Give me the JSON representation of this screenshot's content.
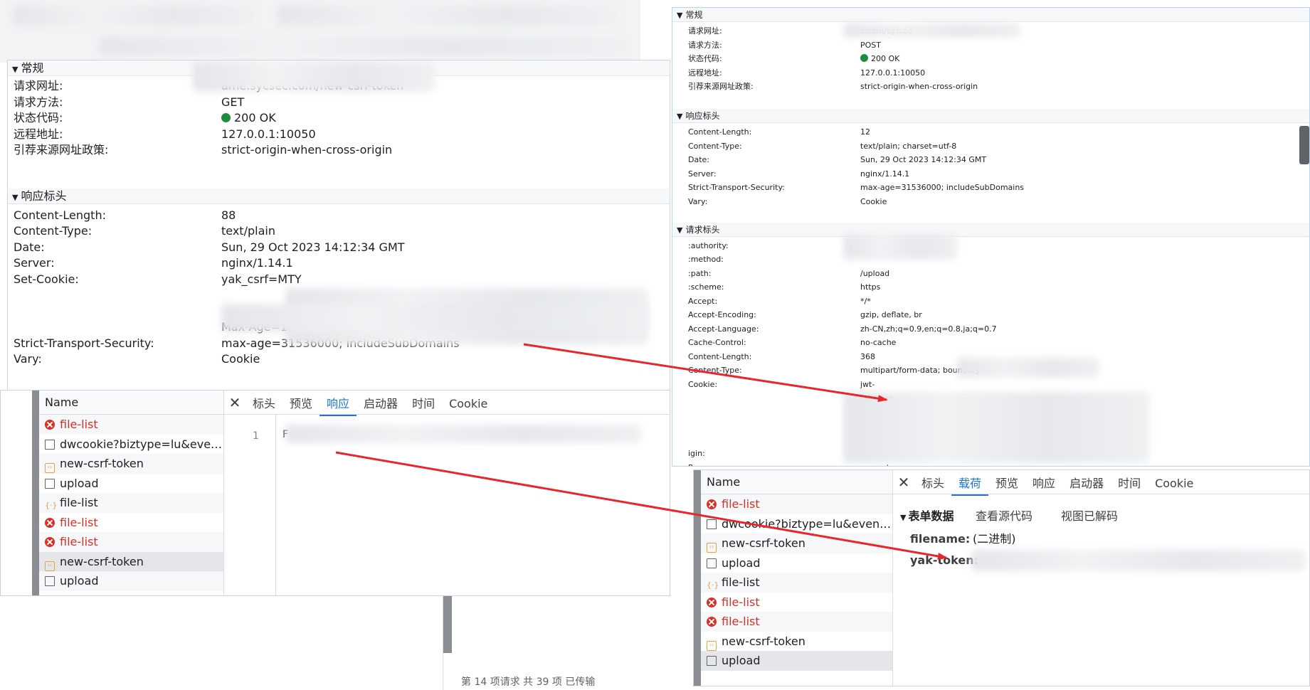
{
  "colors": {
    "accent": "#1a73e8",
    "error": "#d93025",
    "ok": "#1e8e3e",
    "arrow": "#e8262b"
  },
  "panel_a": {
    "general_title": "常规",
    "general": [
      {
        "label": "请求网址:",
        "value": "ame.sycsec.com/new-csrf-token"
      },
      {
        "label": "请求方法:",
        "value": "GET"
      },
      {
        "label": "状态代码:",
        "value": "200 OK"
      },
      {
        "label": "远程地址:",
        "value": "127.0.0.1:10050"
      },
      {
        "label": "引荐来源网址政策:",
        "value": "strict-origin-when-cross-origin"
      }
    ],
    "response_title": "响应标头",
    "response": [
      {
        "label": "Content-Length:",
        "value": "88"
      },
      {
        "label": "Content-Type:",
        "value": "text/plain"
      },
      {
        "label": "Date:",
        "value": "Sun, 29 Oct 2023 14:12:34 GMT"
      },
      {
        "label": "Server:",
        "value": "nginx/1.14.1"
      },
      {
        "label": "Set-Cookie:",
        "value": "yak_csrf=MTY"
      },
      {
        "label": "",
        "value": "Max-Age=10; HttpOnly; SameSite=Lax"
      },
      {
        "label": "Strict-Transport-Security:",
        "value": "max-age=31536000; includeSubDomains"
      },
      {
        "label": "Vary:",
        "value": "Cookie"
      }
    ]
  },
  "panel_b": {
    "general_title": "常规",
    "general": [
      {
        "label": "请求网址:",
        "value": "c.com/upload"
      },
      {
        "label": "请求方法:",
        "value": "POST"
      },
      {
        "label": "状态代码:",
        "value": "200 OK"
      },
      {
        "label": "远程地址:",
        "value": "127.0.0.1:10050"
      },
      {
        "label": "引荐来源网址政策:",
        "value": "strict-origin-when-cross-origin"
      }
    ],
    "response_title": "响应标头",
    "response": [
      {
        "label": "Content-Length:",
        "value": "12"
      },
      {
        "label": "Content-Type:",
        "value": "text/plain; charset=utf-8"
      },
      {
        "label": "Date:",
        "value": "Sun, 29 Oct 2023 14:12:34 GMT"
      },
      {
        "label": "Server:",
        "value": "nginx/1.14.1"
      },
      {
        "label": "Strict-Transport-Security:",
        "value": "max-age=31536000; includeSubDomains"
      },
      {
        "label": "Vary:",
        "value": "Cookie"
      }
    ],
    "request_title": "请求标头",
    "request": [
      {
        "label": ":authority:",
        "value": "e.sycsec.com"
      },
      {
        "label": ":method:",
        "value": ""
      },
      {
        "label": ":path:",
        "value": "/upload"
      },
      {
        "label": ":scheme:",
        "value": "https"
      },
      {
        "label": "Accept:",
        "value": "*/*"
      },
      {
        "label": "Accept-Encoding:",
        "value": "gzip, deflate, br"
      },
      {
        "label": "Accept-Language:",
        "value": "zh-CN,zh;q=0.9,en;q=0.8,ja;q=0.7"
      },
      {
        "label": "Cache-Control:",
        "value": "no-cache"
      },
      {
        "label": "Content-Length:",
        "value": "368"
      },
      {
        "label": "Content-Type:",
        "value": "multipart/form-data; boundary=--"
      },
      {
        "label": "Cookie:",
        "value": "jwt-"
      },
      {
        "label": "",
        "value": "token=e"
      },
      {
        "label": "igin:",
        "value": ""
      },
      {
        "label": "Pragma:",
        "value": "no-cache"
      }
    ]
  },
  "net_left": {
    "name_header": "Name",
    "requests": [
      {
        "name": "file-list",
        "type": "err"
      },
      {
        "name": "dwcookie?biztype=lu&eventi...",
        "type": "doc"
      },
      {
        "name": "new-csrf-token",
        "type": "xhr"
      },
      {
        "name": "upload",
        "type": "doc"
      },
      {
        "name": "file-list",
        "type": "js"
      },
      {
        "name": "file-list",
        "type": "err"
      },
      {
        "name": "file-list",
        "type": "err"
      },
      {
        "name": "new-csrf-token",
        "type": "xhr"
      },
      {
        "name": "upload",
        "type": "doc"
      }
    ],
    "tabs": [
      "标头",
      "预览",
      "响应",
      "启动器",
      "时间",
      "Cookie"
    ],
    "active_tab": "响应",
    "line_number": "1",
    "response_text": "F"
  },
  "net_right": {
    "name_header": "Name",
    "requests": [
      {
        "name": "file-list",
        "type": "err"
      },
      {
        "name": "dwcookie?biztype=lu&eventi...",
        "type": "doc"
      },
      {
        "name": "new-csrf-token",
        "type": "xhr"
      },
      {
        "name": "upload",
        "type": "doc"
      },
      {
        "name": "file-list",
        "type": "js"
      },
      {
        "name": "file-list",
        "type": "err"
      },
      {
        "name": "file-list",
        "type": "err"
      },
      {
        "name": "new-csrf-token",
        "type": "xhr"
      },
      {
        "name": "upload",
        "type": "doc"
      }
    ],
    "tabs": [
      "标头",
      "载荷",
      "预览",
      "响应",
      "启动器",
      "时间",
      "Cookie"
    ],
    "active_tab": "载荷",
    "form_title": "表单数据",
    "view_source": "查看源代码",
    "view_decoded": "视图已解码",
    "fields": [
      {
        "name": "filename:",
        "value": "(二进制)"
      },
      {
        "name": "yak-token:",
        "value": ""
      }
    ]
  },
  "status_text": "第 14 项请求   共 39 项   已传输",
  "left_stub": "e"
}
